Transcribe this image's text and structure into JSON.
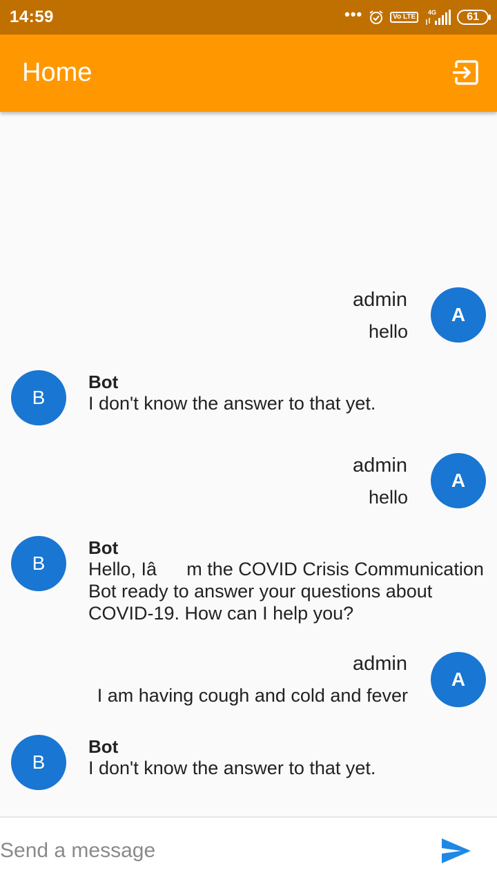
{
  "status_bar": {
    "time": "14:59",
    "network": "4G",
    "volte": "Vo LTE",
    "battery": "61"
  },
  "app_bar": {
    "title": "Home",
    "logout_icon": "logout-icon"
  },
  "messages": [
    {
      "sender": "user",
      "avatar": "A",
      "name": "admin",
      "text": "hello"
    },
    {
      "sender": "bot",
      "avatar": "B",
      "name": "Bot",
      "text": "I don't know the answer to that yet."
    },
    {
      "sender": "user",
      "avatar": "A",
      "name": "admin",
      "text": "hello"
    },
    {
      "sender": "bot",
      "avatar": "B",
      "name": "Bot",
      "text": "Hello, Iâm the COVID Crisis Communication Bot ready to answer your questions about COVID-19. How can I help you?"
    },
    {
      "sender": "user",
      "avatar": "A",
      "name": "admin",
      "text": "I am having cough and cold and fever"
    },
    {
      "sender": "bot",
      "avatar": "B",
      "name": "Bot",
      "text": "I don't know the answer to that yet."
    }
  ],
  "composer": {
    "placeholder": "Send a message",
    "value": "",
    "send_icon": "send-icon"
  },
  "colors": {
    "status_bar": "#c07000",
    "app_bar": "#ff9800",
    "avatar": "#1976d2",
    "send": "#1e88e5"
  }
}
